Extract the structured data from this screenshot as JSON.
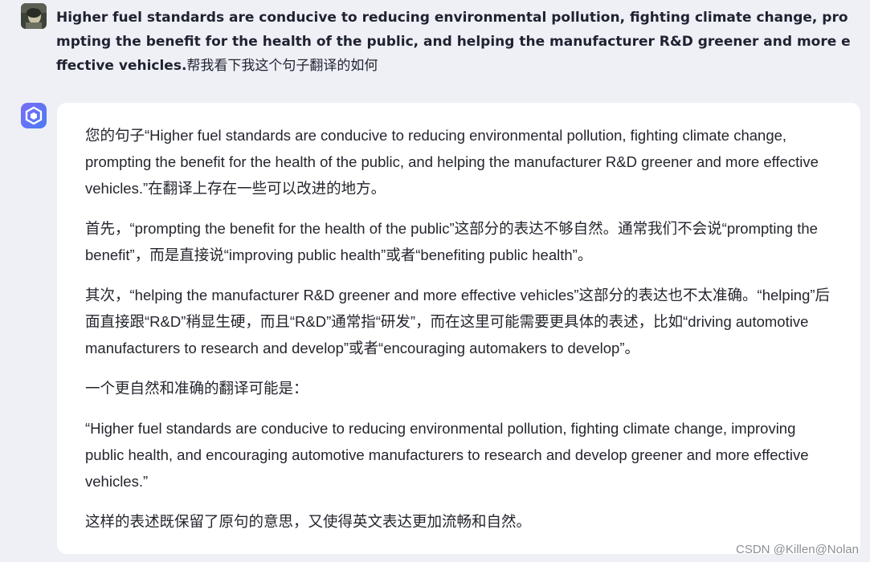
{
  "user_message": {
    "text_en": "Higher fuel standards are conducive to reducing environmental pollution, fighting climate change, prompting the benefit for the health of the public, and helping the manufacturer R&D greener and more effective vehicles.",
    "text_cn": "帮我看下我这个句子翻译的如何"
  },
  "assistant_message": {
    "paragraphs": [
      "您的句子“Higher fuel standards are conducive to reducing environmental pollution, fighting climate change, prompting the benefit for the health of the public, and helping the manufacturer R&D greener and more effective vehicles.”在翻译上存在一些可以改进的地方。",
      "首先，“prompting the benefit for the health of the public”这部分的表达不够自然。通常我们不会说“prompting the benefit”，而是直接说“improving public health”或者“benefiting public health”。",
      "其次，“helping the manufacturer R&D greener and more effective vehicles”这部分的表达也不太准确。“helping”后面直接跟“R&D”稍显生硬，而且“R&D”通常指“研发”，而在这里可能需要更具体的表述，比如“driving automotive manufacturers to research and develop”或者“encouraging automakers to develop”。",
      "一个更自然和准确的翻译可能是：",
      "“Higher fuel standards are conducive to reducing environmental pollution, fighting climate change, improving public health, and encouraging automotive manufacturers to research and develop greener and more effective vehicles.”",
      "这样的表述既保留了原句的意思，又使得英文表达更加流畅和自然。"
    ]
  },
  "watermark": "CSDN @Killen@Nolan",
  "icons": {
    "user_avatar": "user-photo-avatar",
    "bot_avatar": "cube-logo-icon"
  },
  "colors": {
    "page_bg": "#eef0f6",
    "card_bg": "#ffffff",
    "bot_avatar_bg": "#5b6cf5"
  }
}
